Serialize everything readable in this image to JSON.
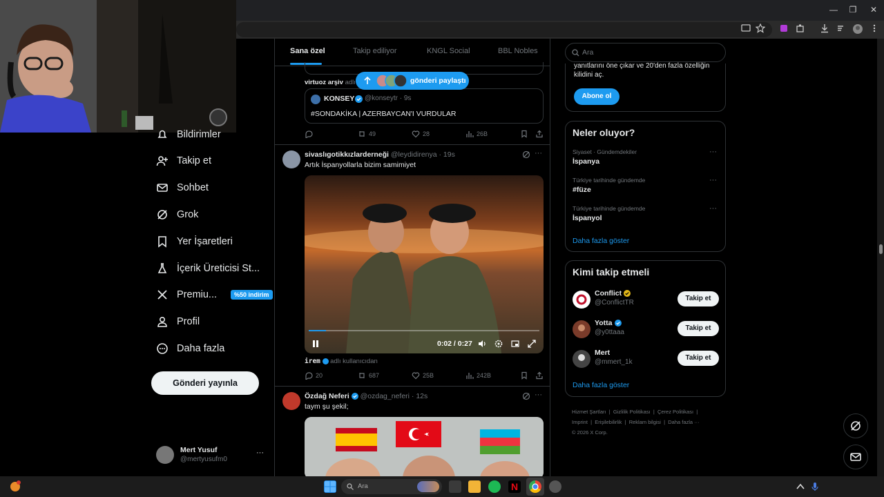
{
  "browser": {
    "win_min": "—",
    "win_max": "❐",
    "win_close": "✕"
  },
  "nav": {
    "items": [
      {
        "label": "Bildirimler"
      },
      {
        "label": "Takip et"
      },
      {
        "label": "Sohbet"
      },
      {
        "label": "Grok"
      },
      {
        "label": "Yer İşaretleri"
      },
      {
        "label": "İçerik Üreticisi St..."
      },
      {
        "label": "Premiu...",
        "badge": "%50 indirim"
      },
      {
        "label": "Profil"
      },
      {
        "label": "Daha fazla"
      }
    ],
    "post_button": "Gönderi yayınla",
    "account": {
      "name": "Mert Yusuf",
      "handle": "@mertyusufm0",
      "more": "···"
    }
  },
  "feed": {
    "tabs": [
      "Sana özel",
      "Takip ediliyor",
      "KNGL Social",
      "BBL Nobles"
    ],
    "new_posts_label": "gönderi paylaştı",
    "post1": {
      "repost_author": "virtuoz arşiv",
      "repost_suffix": "adlı k",
      "quote_name": "KONSEY",
      "quote_handle": "@konseytr · 9s",
      "quote_text": "#SONDAKİKA | AZERBAYCAN'I VURDULAR",
      "replies": "",
      "reposts": "49",
      "likes": "28",
      "views": "26B"
    },
    "post2": {
      "author": "sivaslıgotikkızlarderneği",
      "handle": "@leydidirenya · 19s",
      "text": "Artık  İspanyollarla bizim samimiyet",
      "video_time": "0:02 / 0:27",
      "video_progress": 0.074,
      "credit_user": "irem",
      "credit_suffix": "adlı kullanıcıdan",
      "replies": "20",
      "reposts": "687",
      "likes": "25B",
      "views": "242B"
    },
    "post3": {
      "author": "Özdağ Neferi",
      "handle": "@ozdag_neferi · 12s",
      "text": "taym şu şekil;"
    }
  },
  "sidebar": {
    "search_placeholder": "Ara",
    "premium_text": "yanıtlarını öne çıkar ve 20'den fazla özelliğin kilidini aç.",
    "subscribe_button": "Abone ol",
    "trends_title": "Neler oluyor?",
    "trends": [
      {
        "context": "Siyaset · Gündemdekiler",
        "name": "İspanya"
      },
      {
        "context": "Türkiye tarihinde gündemde",
        "name": "#füze"
      },
      {
        "context": "Türkiye tarihinde gündemde",
        "name": "İspanyol"
      }
    ],
    "trends_more": "Daha fazla göster",
    "who_title": "Kimi takip etmeli",
    "who": [
      {
        "name": "Conflict",
        "handle": "@ConflictTR",
        "verified": "gold",
        "button": "Takip et"
      },
      {
        "name": "Yotta",
        "handle": "@y0ttaaa",
        "verified": "blue",
        "button": "Takip et"
      },
      {
        "name": "Mert",
        "handle": "@mmert_1k",
        "verified": "",
        "button": "Takip et"
      }
    ],
    "who_more": "Daha fazla göster",
    "footer": [
      "Hizmet Şartları",
      "Gizlilik Politikası",
      "Çerez Politikası",
      "Imprint",
      "Erişilebilirlik",
      "Reklam bilgisi",
      "Daha fazla ···",
      "© 2026 X Corp."
    ]
  },
  "taskbar": {
    "search_placeholder": "Ara"
  },
  "colors": {
    "accent": "#1d9bf0",
    "gold": "#e2b719",
    "background": "#000000",
    "border": "#2f3336"
  }
}
